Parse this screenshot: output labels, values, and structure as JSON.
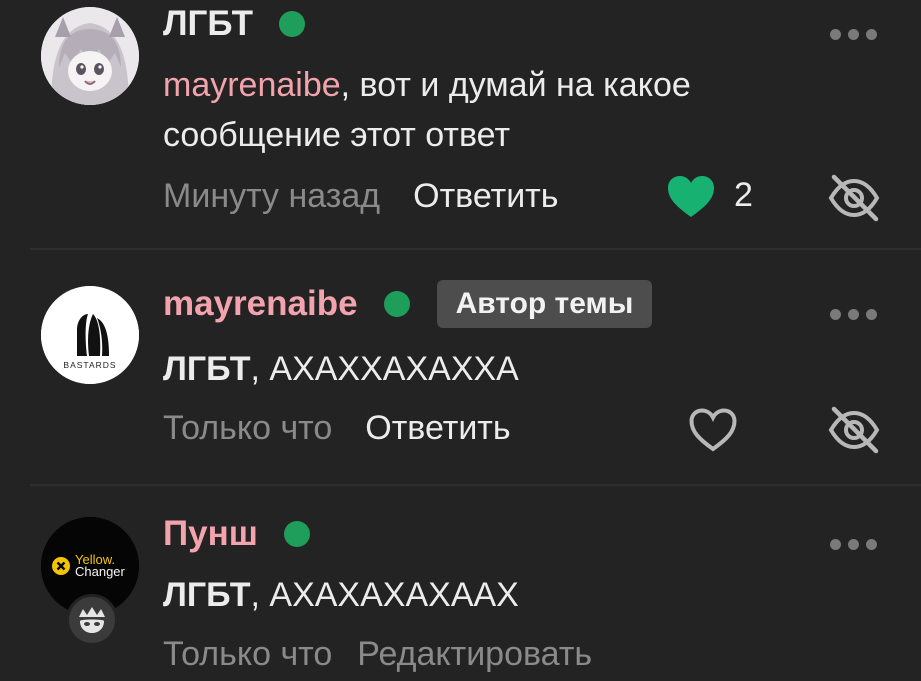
{
  "comments": [
    {
      "author": "ЛГБТ",
      "mention": "mayrenaibe",
      "body": ", вот и думай на какое сообщение этот ответ",
      "time": "Минуту назад",
      "reply_label": "Ответить",
      "likes": "2",
      "liked": true
    },
    {
      "author": "mayrenaibe",
      "badge": "Автор темы",
      "avatar_text": "BASTARDS",
      "mention": "ЛГБТ",
      "body": ", АХАХХАХАХХА",
      "time": "Только что",
      "reply_label": "Ответить",
      "liked": false
    },
    {
      "author": "Пунш",
      "avatar_text_top": "Yellow.",
      "avatar_text_bottom": "Changer",
      "mention": "ЛГБТ",
      "body": ", АХАХАХАХААХ",
      "time": "Только что",
      "edit_label": "Редактировать"
    }
  ],
  "colors": {
    "background": "#232323",
    "online": "#1f9d5a",
    "accent_pink": "#f3a3ad",
    "like_green": "#17b272",
    "muted": "#8a8a8a"
  },
  "icons": {
    "more": "more-dots-icon",
    "like": "heart-icon",
    "hide": "eye-off-icon",
    "online": "online-dot"
  }
}
